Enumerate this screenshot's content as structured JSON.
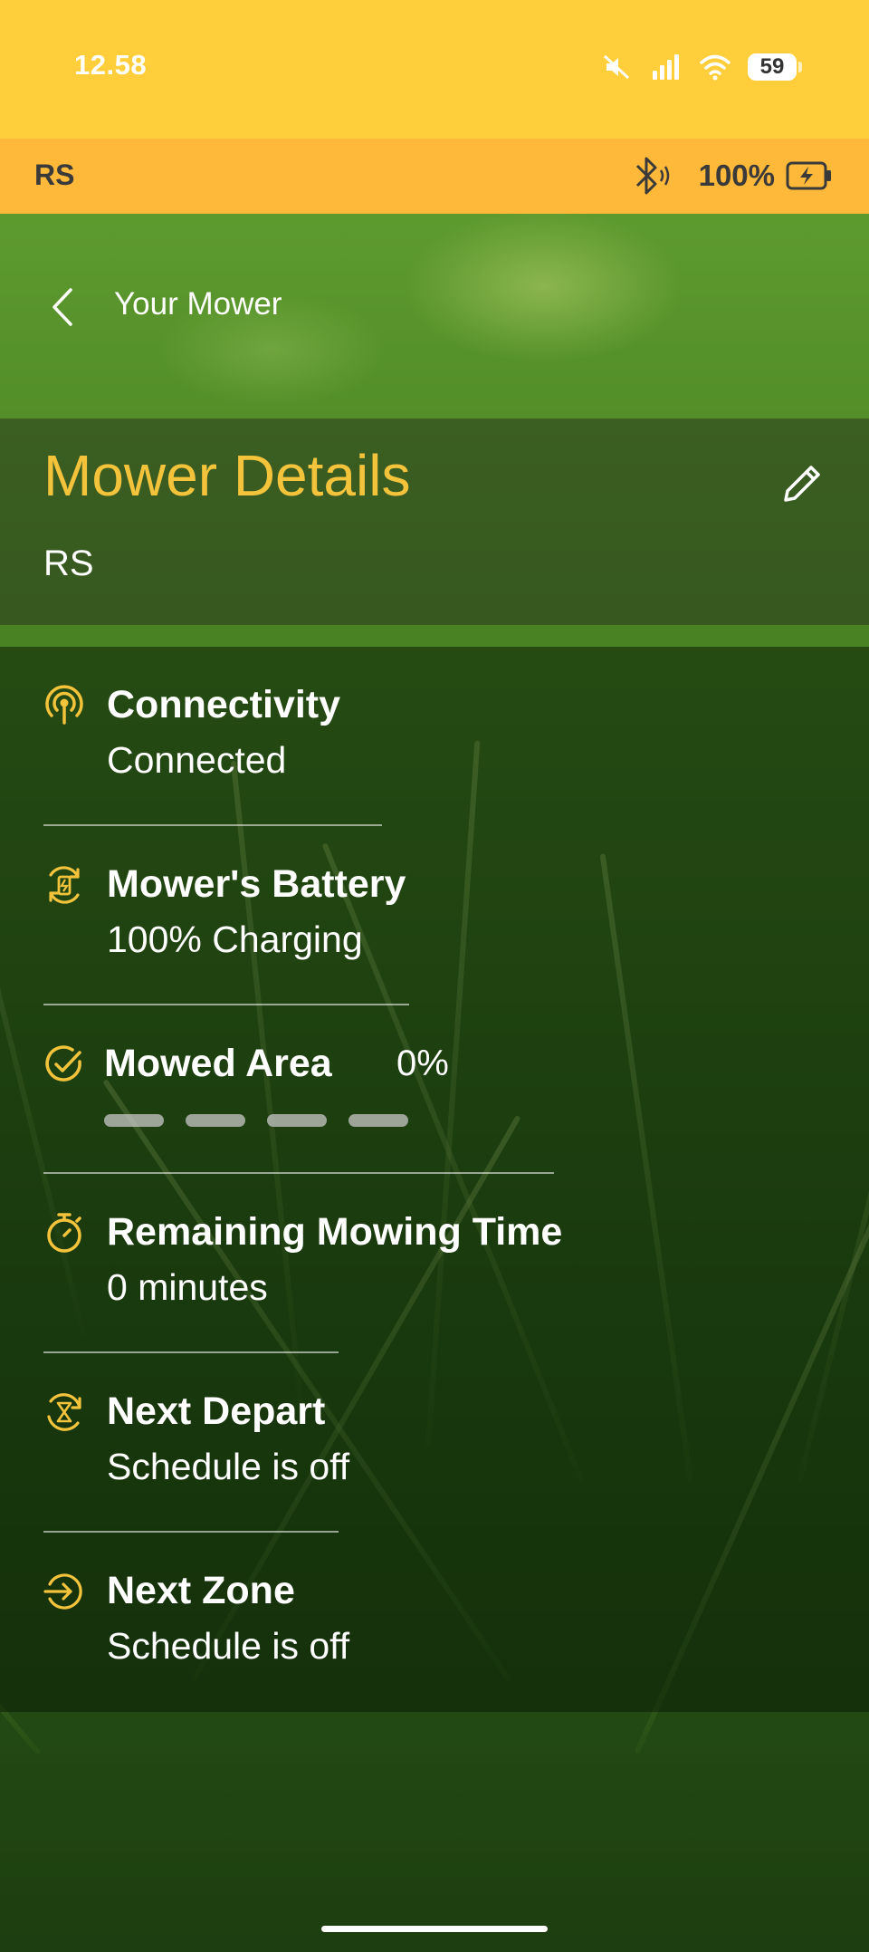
{
  "status_bar": {
    "time": "12.58",
    "battery_level": "59",
    "icons": [
      "mute-icon",
      "signal-icon",
      "wifi-icon",
      "battery-icon"
    ]
  },
  "device_bar": {
    "name": "RS",
    "battery_text": "100%",
    "icons": [
      "bluetooth-icon",
      "charging-battery-icon"
    ]
  },
  "nav": {
    "back_label": "Your Mower"
  },
  "header": {
    "title": "Mower Details",
    "subtitle": "RS"
  },
  "details": {
    "connectivity": {
      "title": "Connectivity",
      "value": "Connected"
    },
    "battery": {
      "title": "Mower's Battery",
      "value": "100% Charging"
    },
    "mowed_area": {
      "title": "Mowed Area",
      "value": "0%",
      "progress_fraction": 0
    },
    "remaining_time": {
      "title": "Remaining Mowing Time",
      "value": "0 minutes"
    },
    "next_depart": {
      "title": "Next Depart",
      "value": "Schedule is off"
    },
    "next_zone": {
      "title": "Next Zone",
      "value": "Schedule is off"
    }
  },
  "colors": {
    "status_bar": "#ffce3a",
    "device_bar": "#ffb93a",
    "accent": "#f4c33c",
    "text": "#ffffff"
  }
}
